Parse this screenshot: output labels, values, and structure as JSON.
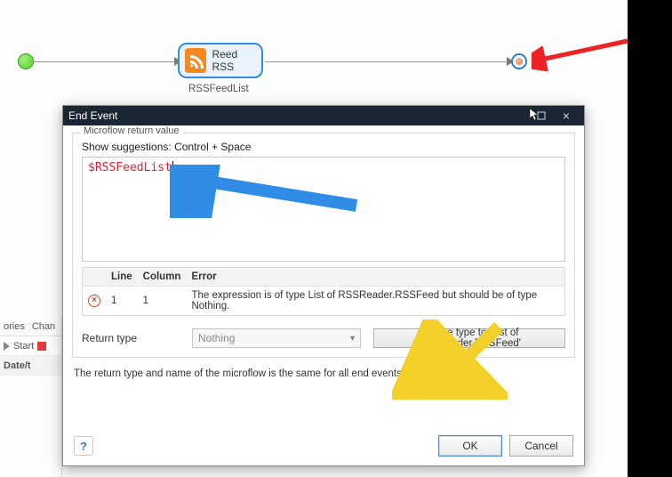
{
  "flow": {
    "activity_label": "Reed RSS",
    "activity_caption": "RSSFeedList",
    "icon_name": "rss-icon"
  },
  "background_panel": {
    "tab1": "ories",
    "tab2": "Chan",
    "row_start": "Start",
    "row_date": "Date/t"
  },
  "dialog": {
    "title": "End Event",
    "group_legend": "Microflow return value",
    "hint": "Show suggestions: Control + Space",
    "expression": "$RSSFeedList",
    "errors": {
      "columns": {
        "line": "Line",
        "column": "Column",
        "error": "Error"
      },
      "rows": [
        {
          "line": "1",
          "column": "1",
          "error": "The expression is of type List of RSSReader.RSSFeed but should be of type Nothing."
        }
      ]
    },
    "return_type_label": "Return type",
    "return_type_value": "Nothing",
    "update_button": "Update type to 'List of RSSReader.RSSFeed'",
    "footer_note": "The return type and name of the microflow is the same for all end events.",
    "help_symbol": "?",
    "ok": "OK",
    "cancel": "Cancel"
  }
}
